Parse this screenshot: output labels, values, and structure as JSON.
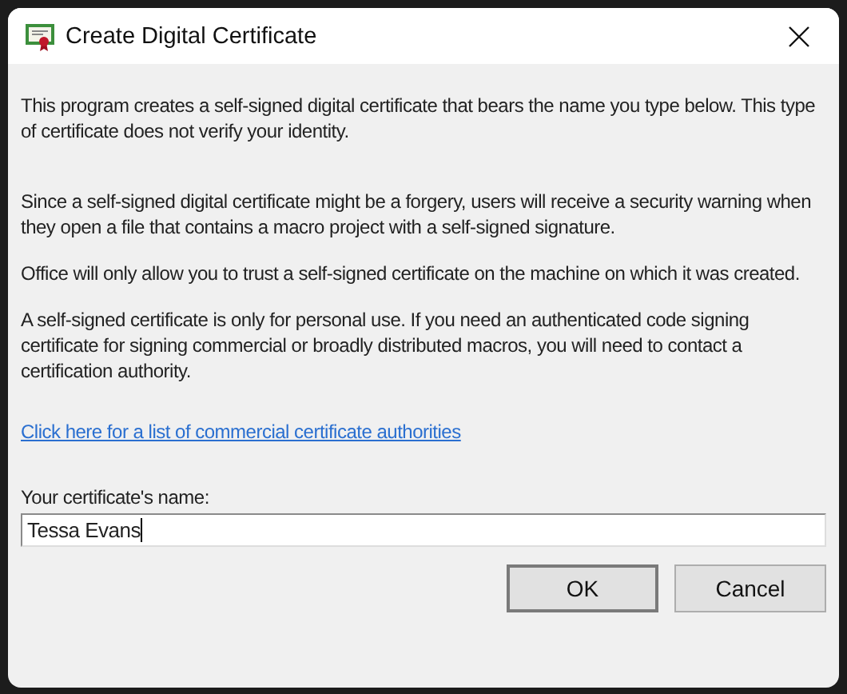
{
  "window": {
    "title": "Create Digital Certificate"
  },
  "paragraphs": [
    "This program creates a self-signed digital certificate that bears the name you type below. This type of certificate does not verify your identity.",
    "Since a self-signed digital certificate might be a forgery, users will receive a security warning when they open a file that contains a macro project with a self-signed signature.",
    "Office will only allow you to trust a self-signed certificate on the machine on which it was created.",
    "A self-signed certificate is only for personal use. If you need an authenticated code signing certificate for signing commercial or broadly distributed macros, you will need to contact a certification authority."
  ],
  "link": "Click here for a list of commercial certificate authorities",
  "name_field": {
    "label": "Your certificate's name:",
    "value": "Tessa Evans"
  },
  "buttons": [
    {
      "label": "OK",
      "default": true
    },
    {
      "label": "Cancel",
      "default": false
    }
  ]
}
